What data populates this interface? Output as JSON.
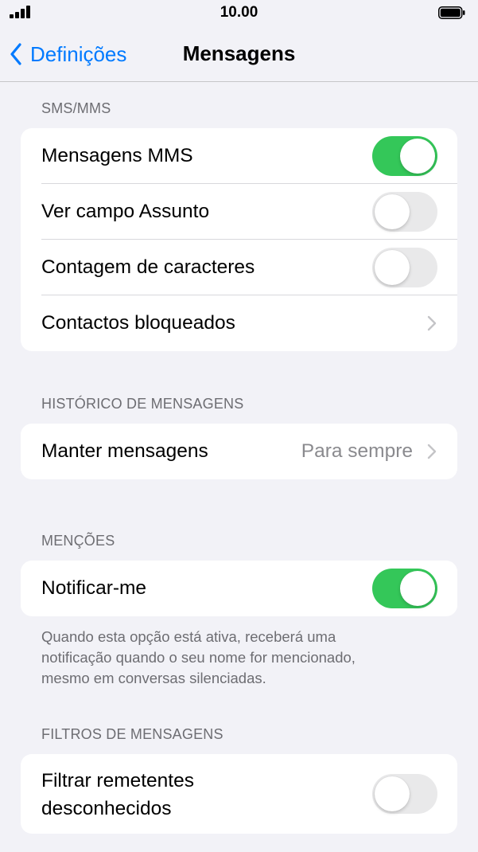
{
  "status_bar": {
    "time": "10.00"
  },
  "nav": {
    "back_label": "Definições",
    "title": "Mensagens"
  },
  "sections": {
    "sms": {
      "header": "SMS/MMS",
      "mms_label": "Mensagens MMS",
      "mms_on": true,
      "subject_label": "Ver campo Assunto",
      "subject_on": false,
      "char_count_label": "Contagem de caracteres",
      "char_count_on": false,
      "blocked_label": "Contactos bloqueados"
    },
    "history": {
      "header": "HISTÓRICO DE MENSAGENS",
      "keep_label": "Manter mensagens",
      "keep_value": "Para sempre"
    },
    "mentions": {
      "header": "MENÇÕES",
      "notify_label": "Notificar-me",
      "notify_on": true,
      "footer_line1": "Quando esta opção está ativa, receberá uma",
      "footer_line2": "notificação quando o seu nome for mencionado,",
      "footer_line3": "mesmo em conversas silenciadas."
    },
    "filters": {
      "header": "FILTROS DE MENSAGENS",
      "filter_label_line1": "Filtrar remetentes",
      "filter_label_line2": "desconhecidos",
      "filter_on": false
    }
  },
  "icons": {
    "signal": "cellular-signal-icon",
    "battery": "battery-icon",
    "back": "chevron-left-icon",
    "disclosure": "chevron-right-icon"
  },
  "colors": {
    "accent": "#007aff",
    "toggle_on": "#34c759",
    "toggle_off": "#e9e9ea",
    "background": "#f2f2f7"
  }
}
